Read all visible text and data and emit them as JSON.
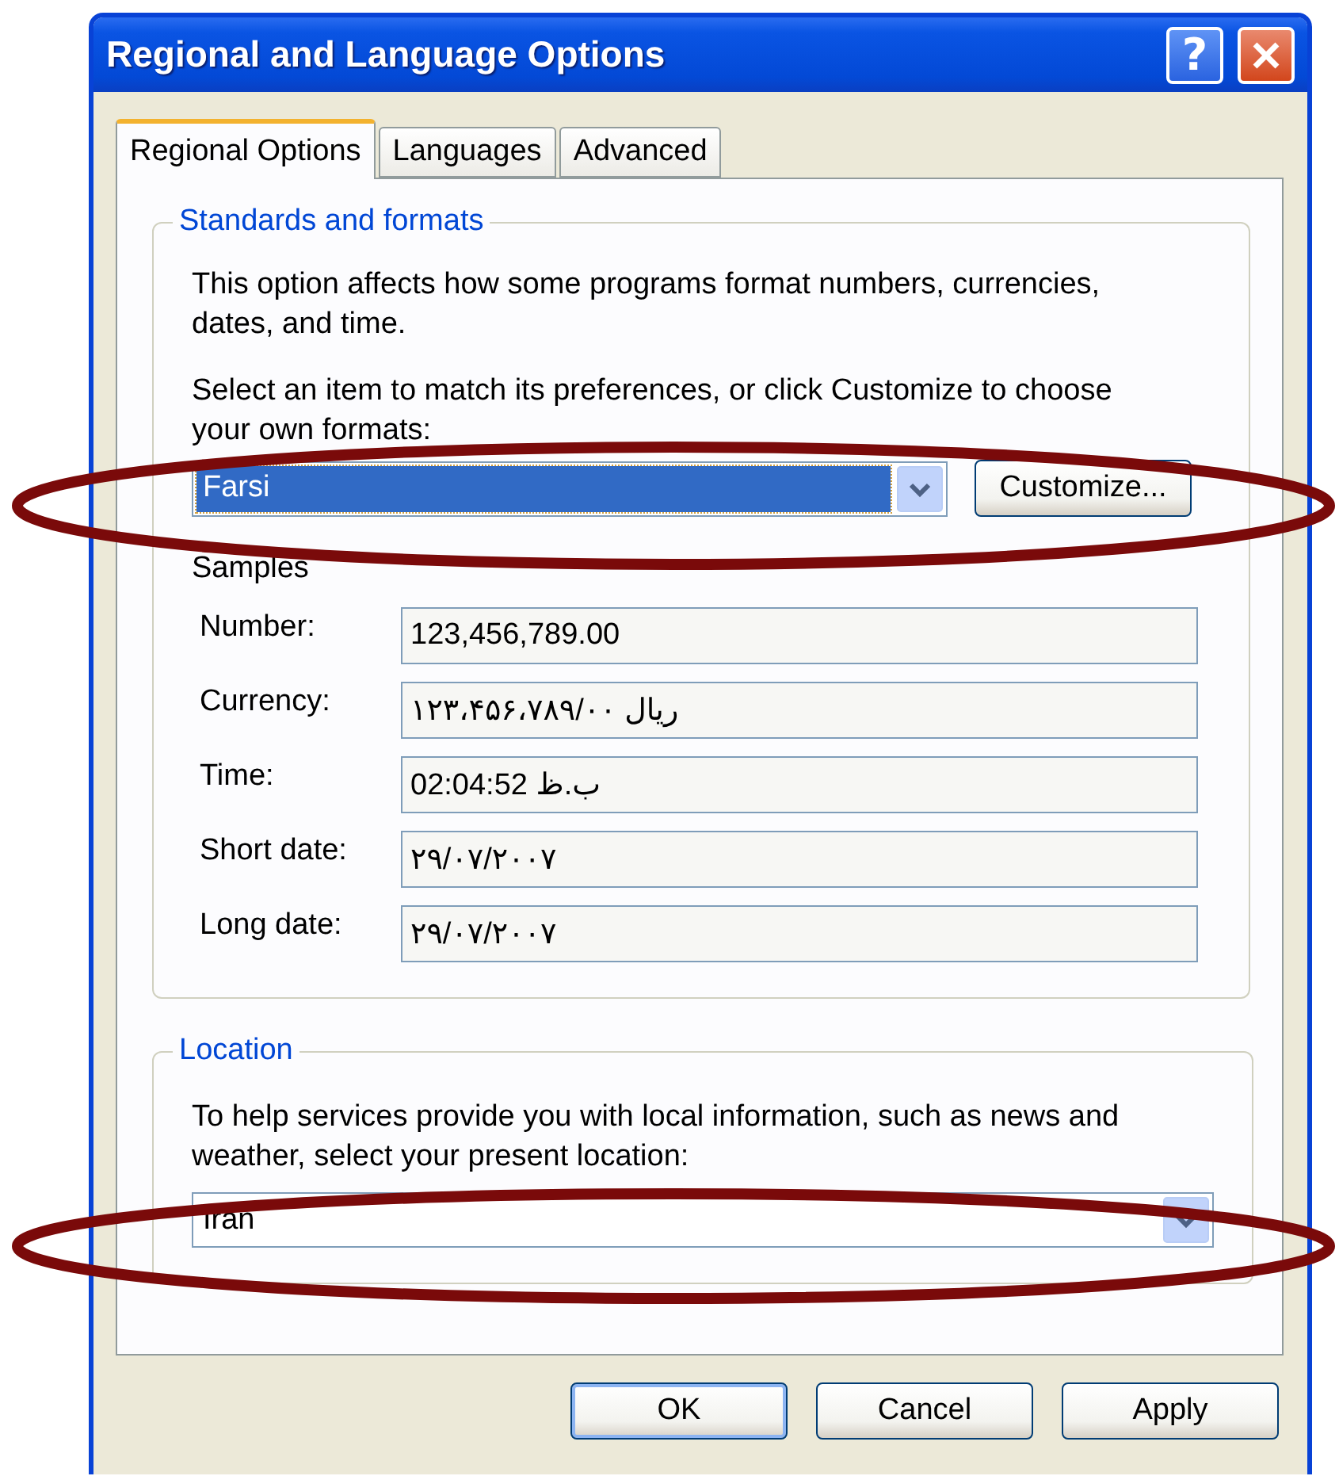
{
  "window": {
    "title": "Regional and Language Options",
    "help_glyph": "?"
  },
  "tabs": [
    {
      "label": "Regional Options",
      "selected": true
    },
    {
      "label": "Languages",
      "selected": false
    },
    {
      "label": "Advanced",
      "selected": false
    }
  ],
  "standards": {
    "title": "Standards and formats",
    "description": "This option affects how some programs format numbers, currencies, dates, and time.",
    "prompt": "Select an item to match its preferences, or click Customize to choose your own formats:",
    "format": {
      "value": "Farsi",
      "focused": true
    },
    "customize_button": "Customize...",
    "samples_title": "Samples",
    "samples": [
      {
        "label": "Number:",
        "value": "123,456,789.00"
      },
      {
        "label": "Currency:",
        "value": "ریال ۱۲۳،۴۵۶،۷۸۹/۰۰"
      },
      {
        "label": "Time:",
        "value": "02:04:52 ب.ظ"
      },
      {
        "label": "Short date:",
        "value": "۲۹/۰۷/۲۰۰۷"
      },
      {
        "label": "Long date:",
        "value": "۲۹/۰۷/۲۰۰۷"
      }
    ]
  },
  "location": {
    "title": "Location",
    "description": "To help services provide you with local information, such as news and weather, select your present location:",
    "value": "Iran"
  },
  "buttons": [
    {
      "label": "OK",
      "default": true
    },
    {
      "label": "Cancel",
      "default": false
    },
    {
      "label": "Apply",
      "default": false
    }
  ],
  "annotations": [
    {
      "kind": "ellipse"
    },
    {
      "kind": "ellipse"
    }
  ]
}
